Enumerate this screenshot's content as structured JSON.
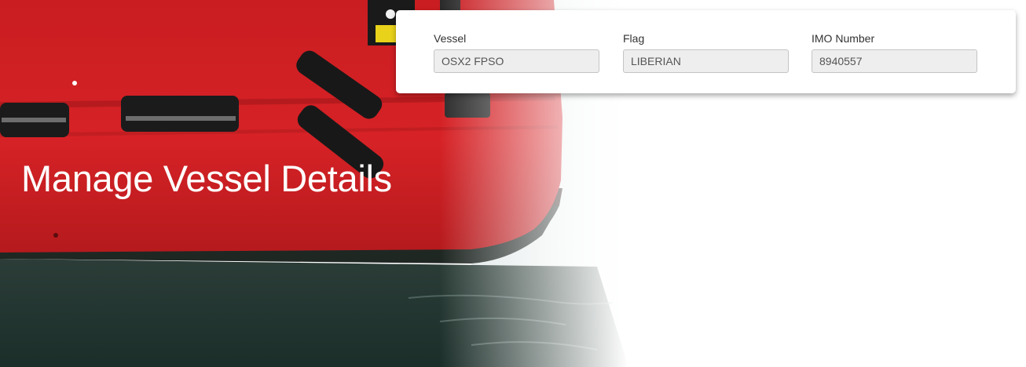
{
  "hero": {
    "title": "Manage Vessel Details",
    "colors": {
      "hull_red": "#d32024",
      "hull_dark": "#8f1416",
      "water": "#1e3530",
      "title_text": "#ffffff"
    }
  },
  "vessel_details": {
    "vessel": {
      "label": "Vessel",
      "value": "OSX2 FPSO"
    },
    "flag": {
      "label": "Flag",
      "value": "LIBERIAN"
    },
    "imo": {
      "label": "IMO Number",
      "value": "8940557"
    }
  }
}
